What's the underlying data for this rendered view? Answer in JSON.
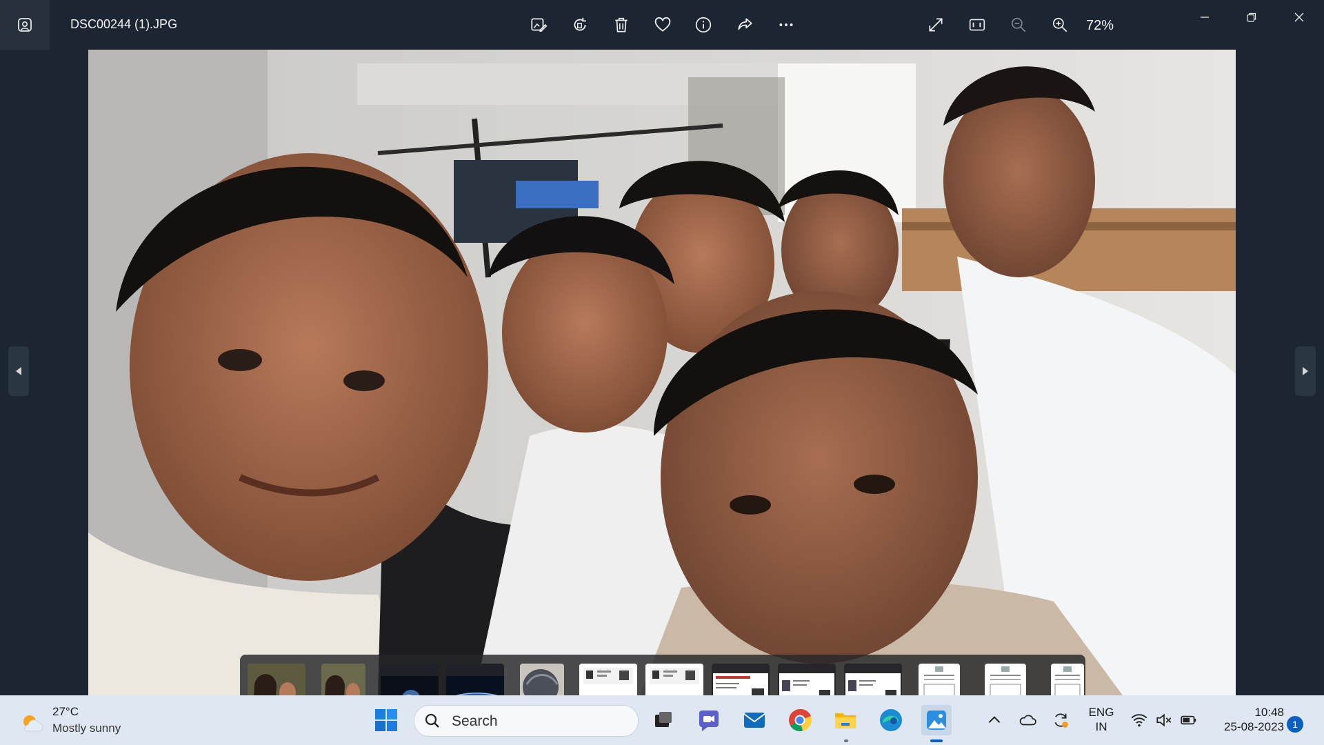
{
  "titlebar": {
    "app_icon": "photos-app-icon",
    "file_name": "DSC00244 (1).JPG",
    "actions": [
      {
        "name": "edit-image-icon"
      },
      {
        "name": "rotate-icon"
      },
      {
        "name": "delete-icon"
      },
      {
        "name": "favorite-heart-icon"
      },
      {
        "name": "info-icon"
      },
      {
        "name": "share-icon"
      },
      {
        "name": "more-options-icon"
      }
    ],
    "view_actions": [
      {
        "name": "full-screen-icon"
      },
      {
        "name": "actual-size-icon"
      },
      {
        "name": "zoom-out-icon"
      },
      {
        "name": "zoom-in-icon"
      }
    ],
    "zoom": "72%",
    "window_controls": [
      "minimize-icon",
      "restore-icon",
      "close-icon"
    ]
  },
  "viewer": {
    "prev": "previous-arrow-icon",
    "next": "next-arrow-icon"
  },
  "filmstrip": {
    "thumbnails": [
      {
        "kind": "photo-group",
        "selected": false
      },
      {
        "kind": "photo-group",
        "selected": false
      },
      {
        "kind": "earth-space",
        "selected": false
      },
      {
        "kind": "earth-horizon",
        "selected": false
      },
      {
        "kind": "hair-photo",
        "selected": false
      },
      {
        "kind": "document",
        "selected": false
      },
      {
        "kind": "document",
        "selected": false
      },
      {
        "kind": "id-card",
        "selected": false
      },
      {
        "kind": "id-card",
        "selected": false
      },
      {
        "kind": "id-card",
        "selected": false
      },
      {
        "kind": "document-page",
        "selected": false
      },
      {
        "kind": "document-page",
        "selected": false
      },
      {
        "kind": "document-page",
        "selected": false
      }
    ]
  },
  "taskbar": {
    "weather": {
      "temp": "27°C",
      "desc": "Mostly sunny",
      "icon": "partly-sunny-icon"
    },
    "start_icon": "windows-start-icon",
    "search": {
      "label": "Search",
      "icon": "search-icon"
    },
    "apps": [
      {
        "name": "task-view-icon"
      },
      {
        "name": "teams-chat-icon"
      },
      {
        "name": "mail-icon"
      },
      {
        "name": "chrome-icon"
      },
      {
        "name": "file-explorer-icon"
      },
      {
        "name": "edge-icon"
      },
      {
        "name": "photos-icon"
      }
    ],
    "tray": {
      "chevron": "chevron-up-icon",
      "onedrive": "onedrive-cloud-icon",
      "sync": "sync-icon",
      "lang_line1": "ENG",
      "lang_line2": "IN",
      "wifi": "wifi-icon",
      "volume": "volume-muted-icon",
      "battery": "battery-icon"
    },
    "clock": {
      "time": "10:48",
      "date": "25-08-2023"
    },
    "notification_count": "1"
  },
  "colors": {
    "titlebar_bg": "#1c2632",
    "taskbar_bg": "#dfe8f2",
    "accent": "#0a5fc2"
  }
}
